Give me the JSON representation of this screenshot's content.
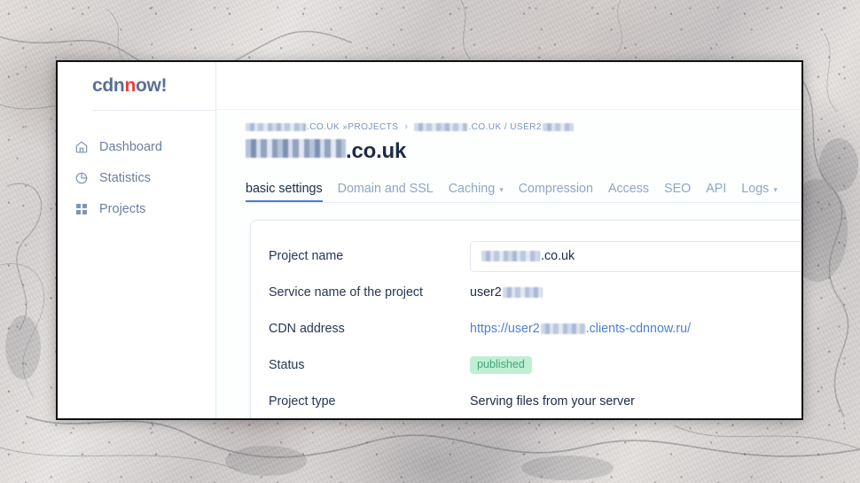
{
  "background": {
    "description": "marble stone texture photo",
    "tones": [
      "#e3dedb",
      "#cdc9c9",
      "#9a9a9f",
      "#4b4b50"
    ]
  },
  "window": {
    "border_color": "#0f0f12",
    "background": "#ffffff"
  },
  "brand": {
    "logo_part1": "cdn",
    "logo_accent": "n",
    "logo_part2": "ow!",
    "accent_color": "#e8413a",
    "logo_color": "#5b6f92"
  },
  "sidebar": {
    "items": [
      {
        "label": "Dashboard",
        "icon": "home-icon"
      },
      {
        "label": "Statistics",
        "icon": "pie-chart-icon"
      },
      {
        "label": "Projects",
        "icon": "grid-icon"
      }
    ]
  },
  "breadcrumb": {
    "item1_redacted": true,
    "item1_suffix": ".CO.UK »PROJECTS",
    "separator": "›",
    "item2_suffix": ".CO.UK / USER2"
  },
  "page": {
    "title_suffix": ".co.uk",
    "title_redacted": true
  },
  "tabs": [
    {
      "label": "basic settings",
      "active": true,
      "caret": false
    },
    {
      "label": "Domain and SSL",
      "active": false,
      "caret": false
    },
    {
      "label": "Caching",
      "active": false,
      "caret": true
    },
    {
      "label": "Compression",
      "active": false,
      "caret": false
    },
    {
      "label": "Access",
      "active": false,
      "caret": false
    },
    {
      "label": "SEO",
      "active": false,
      "caret": false
    },
    {
      "label": "API",
      "active": false,
      "caret": false
    },
    {
      "label": "Logs",
      "active": false,
      "caret": true
    }
  ],
  "form": {
    "project_name": {
      "label": "Project name",
      "value_suffix": ".co.uk",
      "value_redacted": true
    },
    "service_name": {
      "label": "Service name of the project",
      "value_prefix": "user2",
      "value_redacted": true
    },
    "cdn_address": {
      "label": "CDN address",
      "link_prefix": "https://user2",
      "link_suffix": ".clients-cdnnow.ru/",
      "link_color": "#4a80d6",
      "value_redacted": true
    },
    "status": {
      "label": "Status",
      "badge": "published",
      "badge_bg": "#bff0d4",
      "badge_fg": "#47a279"
    },
    "project_type": {
      "label": "Project type",
      "value": "Serving files from your server"
    }
  },
  "colors": {
    "accent_blue": "#4a80d6",
    "text_dark": "#1d2b44",
    "text_muted": "#8fa5c6",
    "border": "#e5eaf1"
  }
}
